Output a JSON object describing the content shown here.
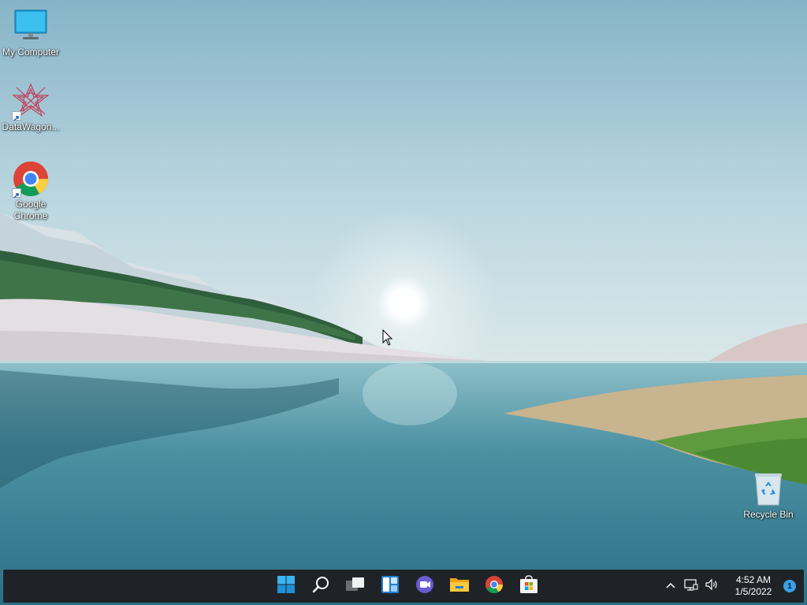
{
  "desktop": {
    "icons": [
      {
        "label": "My Computer",
        "icon": "monitor-icon"
      },
      {
        "label": "DataWagon...",
        "icon": "datawagon-icon"
      },
      {
        "label": "Google Chrome",
        "icon": "chrome-icon"
      },
      {
        "label": "Recycle Bin",
        "icon": "recycle-bin-icon"
      }
    ]
  },
  "taskbar": {
    "pinned": [
      {
        "name": "Start",
        "icon": "windows-start-icon"
      },
      {
        "name": "Search",
        "icon": "search-icon"
      },
      {
        "name": "Task View",
        "icon": "task-view-icon"
      },
      {
        "name": "Widgets",
        "icon": "widgets-icon"
      },
      {
        "name": "Chat",
        "icon": "chat-icon"
      },
      {
        "name": "File Explorer",
        "icon": "folder-icon"
      },
      {
        "name": "Google Chrome",
        "icon": "chrome-icon"
      },
      {
        "name": "Microsoft Store",
        "icon": "store-icon"
      }
    ],
    "tray": {
      "icons": [
        "chevron-up-icon",
        "network-icon",
        "volume-icon"
      ],
      "time": "4:52 AM",
      "date": "1/5/2022",
      "notification_count": "1"
    }
  },
  "colors": {
    "taskbar_bg": "#1f2327",
    "accent": "#3aa0e6"
  }
}
